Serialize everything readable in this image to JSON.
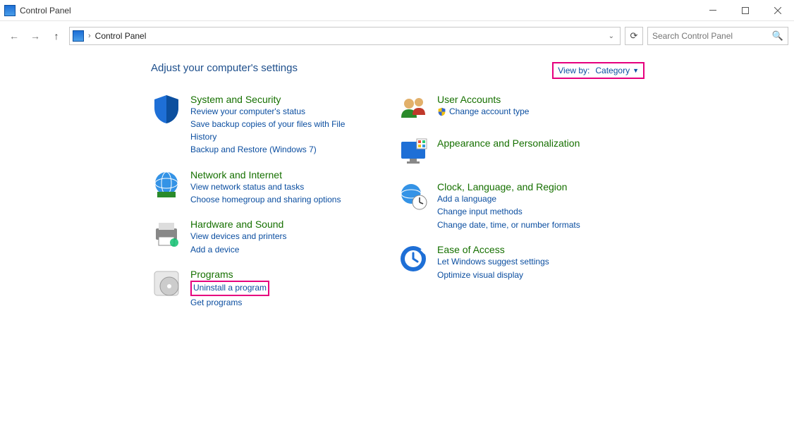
{
  "window": {
    "title": "Control Panel"
  },
  "address": {
    "crumb": "Control Panel"
  },
  "search": {
    "placeholder": "Search Control Panel"
  },
  "heading": "Adjust your computer's settings",
  "viewby": {
    "label": "View by:",
    "value": "Category"
  },
  "left": [
    {
      "title": "System and Security",
      "links": [
        "Review your computer's status",
        "Save backup copies of your files with File History",
        "Backup and Restore (Windows 7)"
      ]
    },
    {
      "title": "Network and Internet",
      "links": [
        "View network status and tasks",
        "Choose homegroup and sharing options"
      ]
    },
    {
      "title": "Hardware and Sound",
      "links": [
        "View devices and printers",
        "Add a device"
      ]
    },
    {
      "title": "Programs",
      "links": [
        "Uninstall a program",
        "Get programs"
      ]
    }
  ],
  "right": [
    {
      "title": "User Accounts",
      "links": [
        "Change account type"
      ],
      "shield": true
    },
    {
      "title": "Appearance and Personalization",
      "links": []
    },
    {
      "title": "Clock, Language, and Region",
      "links": [
        "Add a language",
        "Change input methods",
        "Change date, time, or number formats"
      ]
    },
    {
      "title": "Ease of Access",
      "links": [
        "Let Windows suggest settings",
        "Optimize visual display"
      ]
    }
  ]
}
